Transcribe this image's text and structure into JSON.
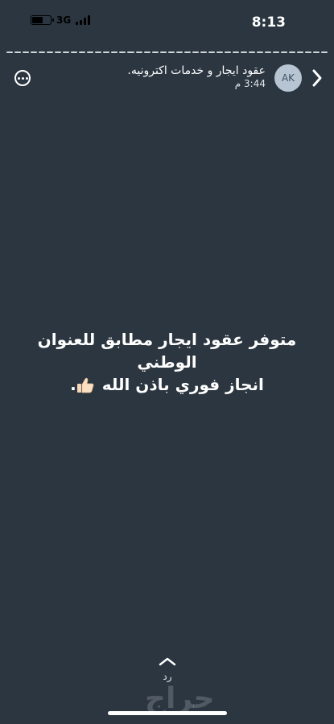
{
  "status_bar": {
    "time": "8:13",
    "network": "3G",
    "battery_level": 0.55,
    "battery_icon": "battery-icon",
    "signal_icon": "signal-bars-icon"
  },
  "story": {
    "progress_segments": 40,
    "title": "عقود ايجار و خدمات اكترونيه.",
    "time": "3:44 م",
    "avatar_initials": "AK",
    "back_icon": "chevron-right-icon",
    "more_icon": "more-options-icon"
  },
  "message": {
    "line1": "متوفر عقود ايجار مطابق للعنوان",
    "line2": "الوطني",
    "line3": "انجاز فوري باذن الله",
    "line3_suffix": ".",
    "emoji_icon": "thumbs-up-icon"
  },
  "reply": {
    "label": "رد",
    "icon": "chevron-up-icon"
  },
  "watermark": "حراج",
  "colors": {
    "background": "#2b3640",
    "text": "#ffffff",
    "avatar_bg": "#b7c5d3"
  }
}
